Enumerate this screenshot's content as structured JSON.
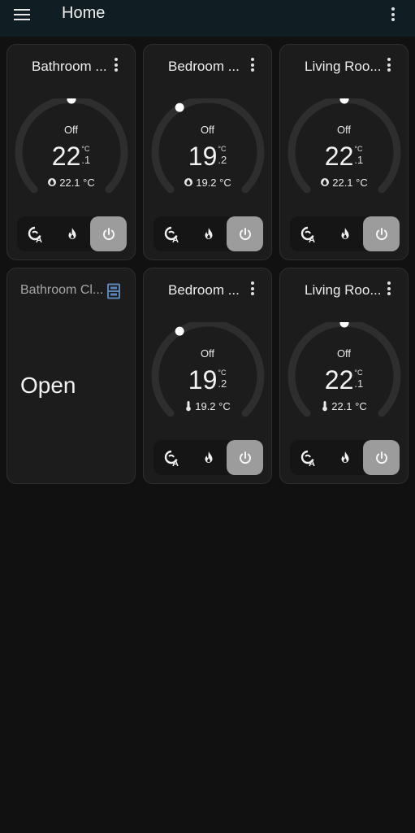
{
  "header": {
    "title": "Home"
  },
  "colors": {
    "background": "#111111",
    "card": "#1c1c1c",
    "header": "#101e24",
    "active_mode": "#9c9c9c",
    "accent": "#5b84b8",
    "track": "#2e2e2e"
  },
  "cards": [
    {
      "name": "Bathroom ...",
      "mode": "Off",
      "temp_int": "22",
      "temp_unit": "°C",
      "temp_dec": ".1",
      "current": "22.1 °C",
      "current_icon": "humidity-icon",
      "setpoint_fraction": 0.5
    },
    {
      "name": "Bedroom ...",
      "mode": "Off",
      "temp_int": "19",
      "temp_unit": "°C",
      "temp_dec": ".2",
      "current": "19.2 °C",
      "current_icon": "humidity-icon",
      "setpoint_fraction": 0.38
    },
    {
      "name": "Living Roo...",
      "mode": "Off",
      "temp_int": "22",
      "temp_unit": "°C",
      "temp_dec": ".1",
      "current": "22.1 °C",
      "current_icon": "humidity-icon",
      "setpoint_fraction": 0.5
    },
    {
      "name": "Bathroom Cl...",
      "state": "Open",
      "icon": "window-icon"
    },
    {
      "name": "Bedroom ...",
      "mode": "Off",
      "temp_int": "19",
      "temp_unit": "°C",
      "temp_dec": ".2",
      "current": "19.2 °C",
      "current_icon": "thermometer-icon",
      "setpoint_fraction": 0.38
    },
    {
      "name": "Living Roo...",
      "mode": "Off",
      "temp_int": "22",
      "temp_unit": "°C",
      "temp_dec": ".1",
      "current": "22.1 °C",
      "current_icon": "thermometer-icon",
      "setpoint_fraction": 0.5
    }
  ],
  "mode_buttons": [
    {
      "icon": "auto-mode-icon",
      "active": false
    },
    {
      "icon": "heat-flame-icon",
      "active": false
    },
    {
      "icon": "power-icon",
      "active": true
    }
  ]
}
